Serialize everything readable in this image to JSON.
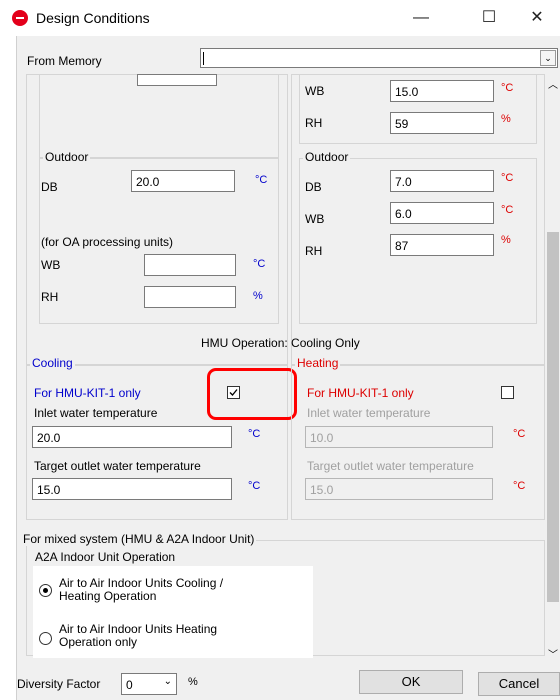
{
  "window": {
    "title": "Design Conditions",
    "minimize_glyph": "—",
    "maximize_glyph": "☐",
    "close_glyph": "✕",
    "icon": "app-logo-icon"
  },
  "memory": {
    "label": "From Memory",
    "value": ""
  },
  "left_top": {
    "field_value": ""
  },
  "right_top": {
    "wb": {
      "label": "WB",
      "value": "15.0",
      "unit": "°C"
    },
    "rh": {
      "label": "RH",
      "value": "59",
      "unit": "%"
    }
  },
  "outdoor_left": {
    "title": "Outdoor",
    "db": {
      "label": "DB",
      "value": "20.0",
      "unit": "°C"
    },
    "note": "(for OA processing units)",
    "wb": {
      "label": "WB",
      "value": "",
      "unit": "°C"
    },
    "rh": {
      "label": "RH",
      "value": "",
      "unit": "%"
    }
  },
  "outdoor_right": {
    "title": "Outdoor",
    "db": {
      "label": "DB",
      "value": "7.0",
      "unit": "°C"
    },
    "wb": {
      "label": "WB",
      "value": "6.0",
      "unit": "°C"
    },
    "rh": {
      "label": "RH",
      "value": "87",
      "unit": "%"
    }
  },
  "hmu_operation": "HMU Operation: Cooling Only",
  "cooling": {
    "title": "Cooling",
    "kit_label": "For HMU-KIT-1 only",
    "checked": true,
    "inlet_label": "Inlet water temperature",
    "inlet_value": "20.0",
    "inlet_unit": "°C",
    "target_label": "Target outlet water temperature",
    "target_value": "15.0",
    "target_unit": "°C"
  },
  "heating": {
    "title": "Heating",
    "kit_label": "For HMU-KIT-1 only",
    "checked": false,
    "inlet_label": "Inlet water temperature",
    "inlet_value": "10.0",
    "inlet_unit": "°C",
    "target_label": "Target outlet water temperature",
    "target_value": "15.0",
    "target_unit": "°C"
  },
  "mixed": {
    "title": "For mixed system  (HMU & A2A Indoor Unit)",
    "subtitle": "A2A Indoor Unit Operation",
    "option1_line1": "Air to Air Indoor Units Cooling /",
    "option1_line2": "Heating Operation",
    "option2_line1": "Air to Air Indoor Units Heating",
    "option2_line2": "Operation only",
    "selected": 1
  },
  "diversity": {
    "label": "Diversity Factor",
    "value": "0",
    "unit": "%"
  },
  "buttons": {
    "ok": "OK",
    "cancel": "Cancel"
  },
  "colors": {
    "accent_red": "#e3001b",
    "unit_blue": "#0000cc",
    "unit_red": "#dd0000",
    "highlight": "#ff0000"
  }
}
